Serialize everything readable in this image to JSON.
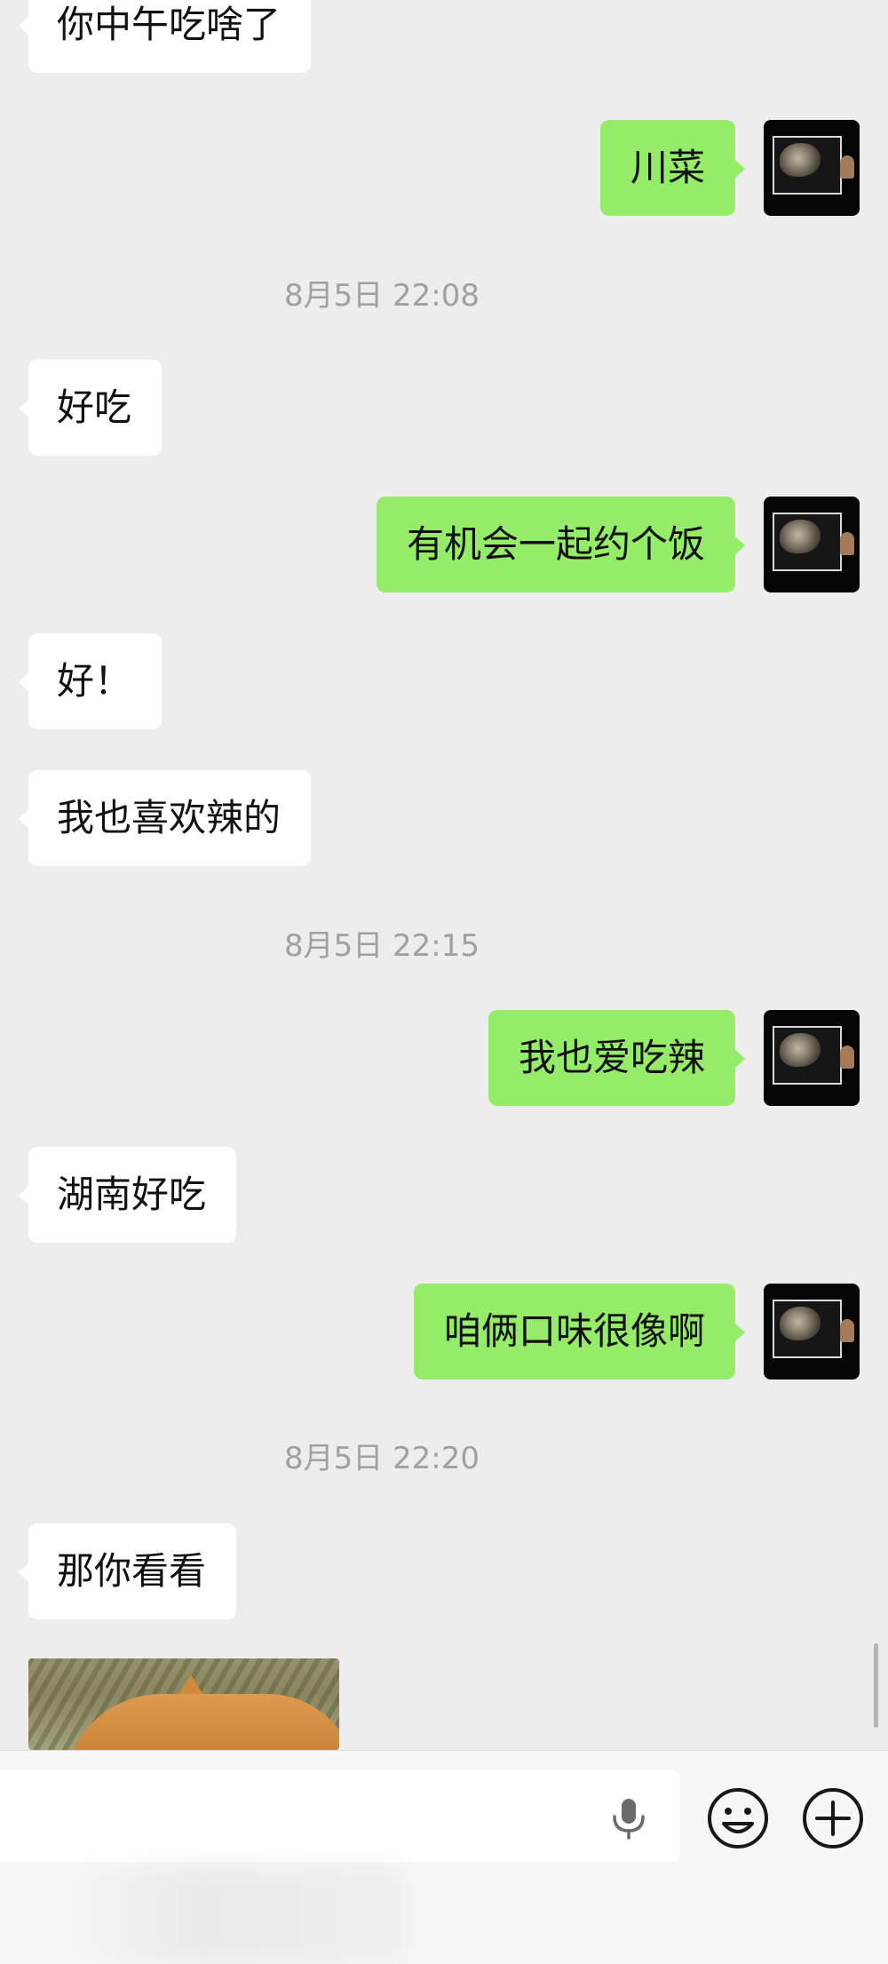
{
  "messages": [
    {
      "side": "left",
      "text": "你中午吃啥了"
    },
    {
      "side": "right",
      "text": "川菜"
    },
    {
      "type": "time",
      "text": "8月5日 22:08"
    },
    {
      "side": "left",
      "text": "好吃"
    },
    {
      "side": "right",
      "text": "有机会一起约个饭"
    },
    {
      "side": "left",
      "text": "好！"
    },
    {
      "side": "left",
      "text": "我也喜欢辣的"
    },
    {
      "type": "time",
      "text": "8月5日 22:15"
    },
    {
      "side": "right",
      "text": "我也爱吃辣"
    },
    {
      "side": "left",
      "text": "湖南好吃"
    },
    {
      "side": "right",
      "text": "咱俩口味很像啊"
    },
    {
      "type": "time",
      "text": "8月5日 22:20"
    },
    {
      "side": "left",
      "text": "那你看看"
    }
  ],
  "colors": {
    "background": "#ededed",
    "bubble_left": "#ffffff",
    "bubble_right": "#95ec69",
    "timestamp": "#a0a0a0"
  },
  "input_bar": {
    "icons": [
      "microphone-icon",
      "emoji-icon",
      "plus-icon"
    ]
  }
}
